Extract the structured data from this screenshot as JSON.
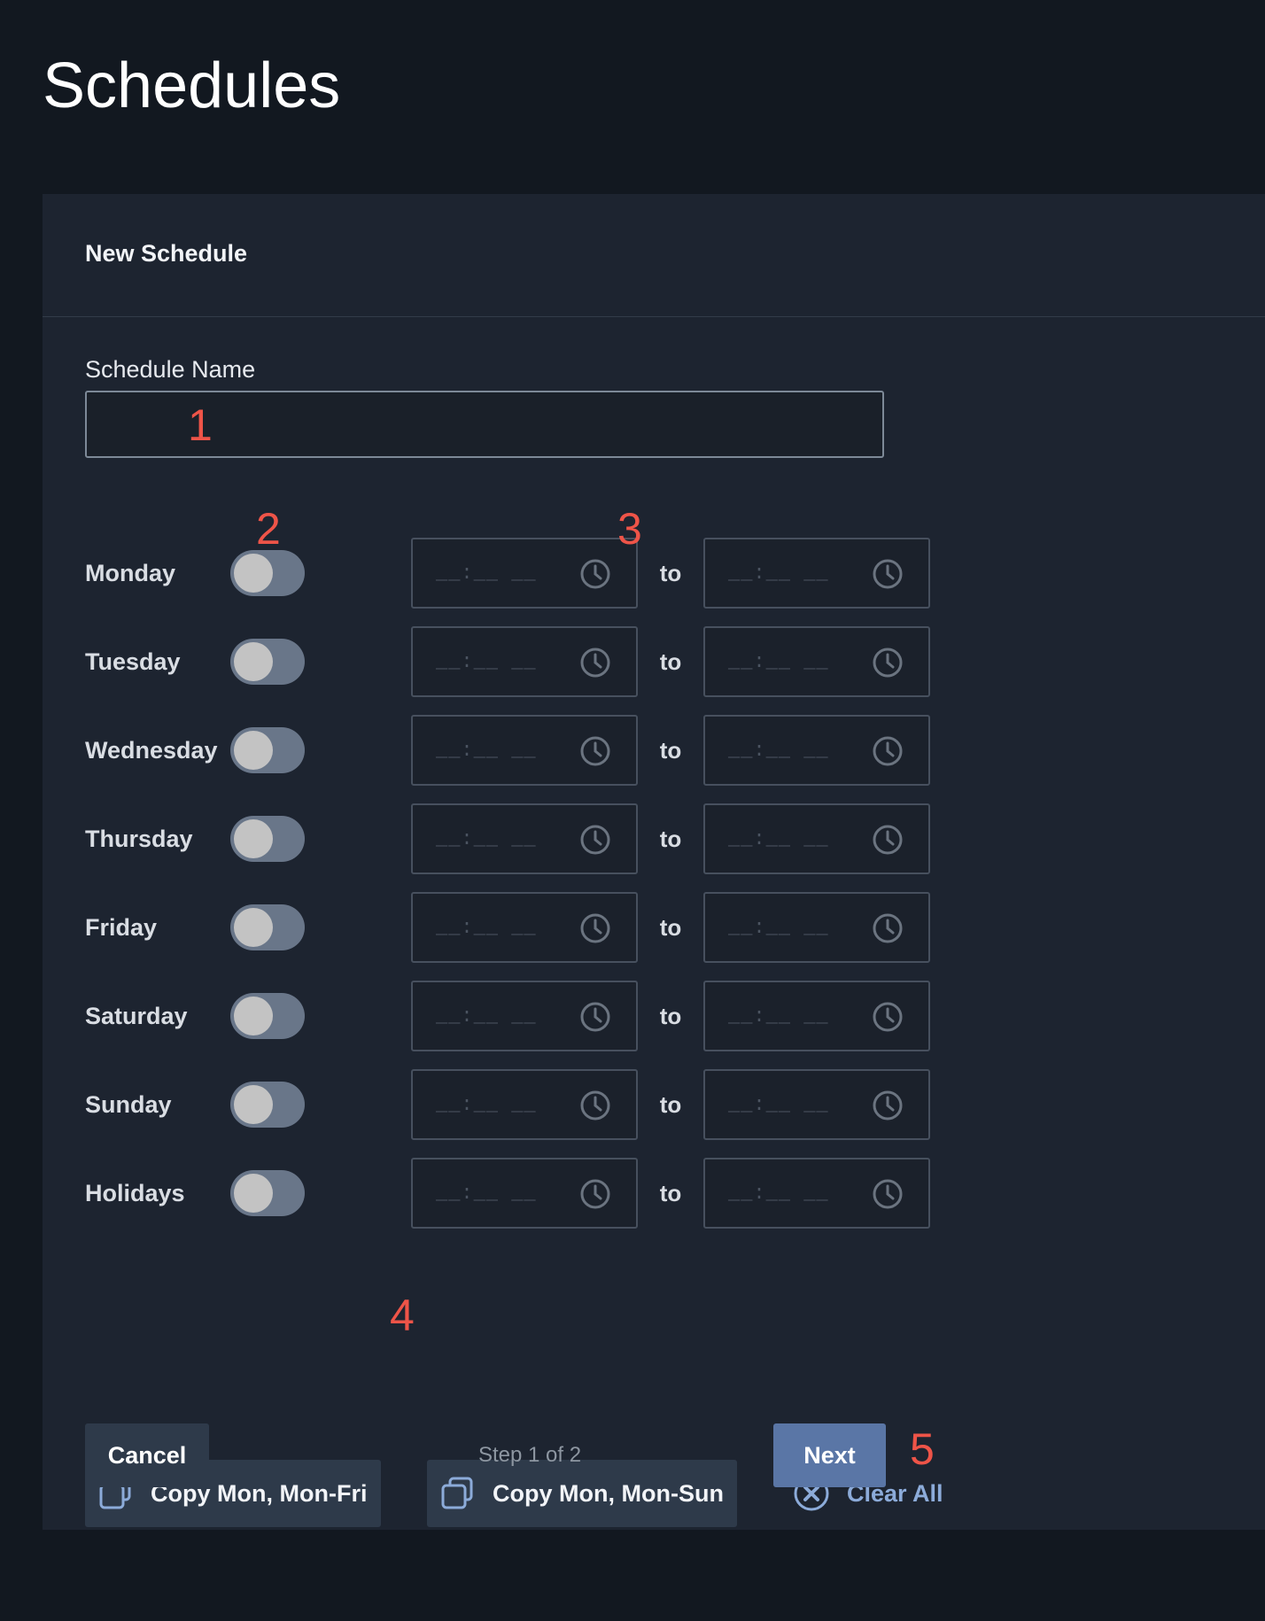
{
  "page_title": "Schedules",
  "card": {
    "title": "New Schedule",
    "schedule_name": {
      "label": "Schedule Name",
      "value": "",
      "placeholder": ""
    },
    "days": [
      {
        "label": "Monday",
        "enabled": false,
        "start_placeholder": "__:__ __",
        "to_label": "to",
        "end_placeholder": "__:__ __"
      },
      {
        "label": "Tuesday",
        "enabled": false,
        "start_placeholder": "__:__ __",
        "to_label": "to",
        "end_placeholder": "__:__ __"
      },
      {
        "label": "Wednesday",
        "enabled": false,
        "start_placeholder": "__:__ __",
        "to_label": "to",
        "end_placeholder": "__:__ __"
      },
      {
        "label": "Thursday",
        "enabled": false,
        "start_placeholder": "__:__ __",
        "to_label": "to",
        "end_placeholder": "__:__ __"
      },
      {
        "label": "Friday",
        "enabled": false,
        "start_placeholder": "__:__ __",
        "to_label": "to",
        "end_placeholder": "__:__ __"
      },
      {
        "label": "Saturday",
        "enabled": false,
        "start_placeholder": "__:__ __",
        "to_label": "to",
        "end_placeholder": "__:__ __"
      },
      {
        "label": "Sunday",
        "enabled": false,
        "start_placeholder": "__:__ __",
        "to_label": "to",
        "end_placeholder": "__:__ __"
      },
      {
        "label": "Holidays",
        "enabled": false,
        "start_placeholder": "__:__ __",
        "to_label": "to",
        "end_placeholder": "__:__ __"
      }
    ],
    "actions": {
      "copy_mon_fri": "Copy Mon, Mon-Fri",
      "copy_mon_sun": "Copy Mon, Mon-Sun",
      "clear_all": "Clear All"
    },
    "footer": {
      "cancel": "Cancel",
      "step": "Step 1 of 2",
      "next": "Next"
    }
  },
  "callouts": [
    "1",
    "2",
    "3",
    "4",
    "5"
  ],
  "icons": {
    "clock": "clock-icon",
    "copy": "copy-icon",
    "clear": "close-circle-icon"
  },
  "colors": {
    "background": "#121820",
    "card": "#1d2430",
    "primary_button": "#5a76a6",
    "secondary_button": "#2e3a4a",
    "link": "#8cabd9",
    "callout": "#ee5448",
    "toggle_off": "#697689"
  }
}
